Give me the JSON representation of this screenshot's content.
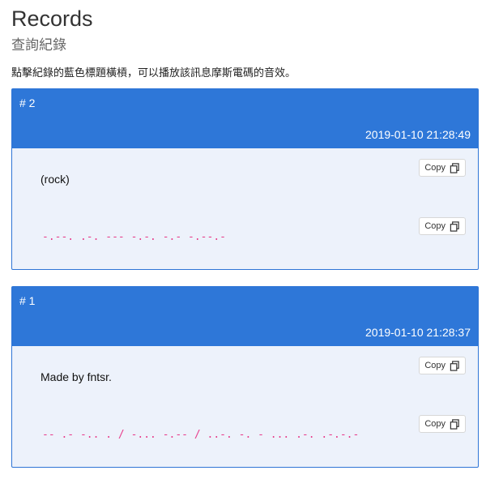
{
  "page": {
    "title": "Records",
    "subtitle": "查詢紀錄",
    "hint": "點擊紀錄的藍色標題橫槓，可以播放該訊息摩斯電碼的音效。"
  },
  "records": [
    {
      "number": "# 2",
      "timestamp": "2019-01-10 21:28:49",
      "text": "(rock)",
      "morse": "-.--. .-. --- -.-. -.- -.--.-",
      "copy_label": "Copy"
    },
    {
      "number": "# 1",
      "timestamp": "2019-01-10 21:28:37",
      "text": "Made by fntsr.",
      "morse": "-- .- -.. . / -... -.-- / ..-. -. - ... .-. .-.-.-",
      "copy_label": "Copy"
    }
  ],
  "colors": {
    "header_blue": "#2e77d8",
    "card_bg": "#edf2fb",
    "morse_pink": "#e83e8c"
  },
  "icons": {
    "copy": "copy-icon"
  }
}
